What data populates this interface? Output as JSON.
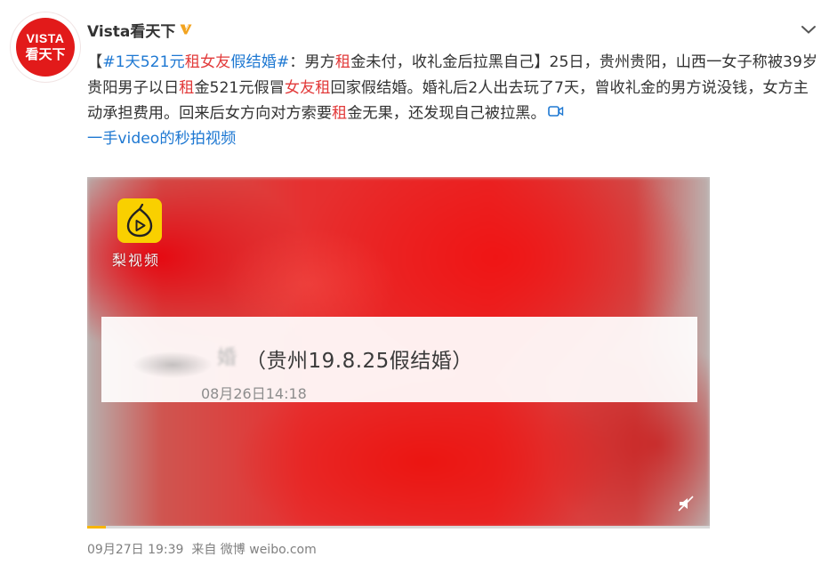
{
  "author": {
    "name": "Vista看天下",
    "avatar_text_top": "VISTA",
    "avatar_text_bottom": "看天下",
    "verified_icon": "verified-badge-icon"
  },
  "post": {
    "segments": [
      {
        "text": "【",
        "style": "normal"
      },
      {
        "text": "#1天521元",
        "style": "link"
      },
      {
        "text": "租",
        "style": "red"
      },
      {
        "text": "女友",
        "style": "red"
      },
      {
        "text": "假结婚#",
        "style": "link"
      },
      {
        "text": "：男方",
        "style": "normal"
      },
      {
        "text": "租",
        "style": "red"
      },
      {
        "text": "金未付，收礼金后拉黑自己】25日，贵州贵阳，山西一女子称被39岁贵阳男子以日",
        "style": "normal"
      },
      {
        "text": "租",
        "style": "red"
      },
      {
        "text": "金521元假冒",
        "style": "normal"
      },
      {
        "text": "女友",
        "style": "red"
      },
      {
        "text": "租",
        "style": "red"
      },
      {
        "text": "回家假结婚。婚礼后2人出去玩了7天，曾收礼金的男方说没钱，女方主动承担费用。回来后女方向对方索要",
        "style": "normal"
      },
      {
        "text": "租",
        "style": "red"
      },
      {
        "text": "金无果，还发现自己被拉黑。",
        "style": "normal"
      }
    ],
    "video_link_text": "一手video的秒拍视频",
    "video_link_icon": "video-link-icon"
  },
  "video": {
    "watermark_logo": "pear-video-logo-icon",
    "watermark_label": "梨视频",
    "banner_title": "（贵州19.8.25假结婚）",
    "banner_blur_char": "婚",
    "banner_time": "08月26日14:18",
    "mute_icon": "mute-speaker-icon",
    "progress": 0.03
  },
  "meta": {
    "date": "09月27日 19:39",
    "from_label": "来自",
    "source": "微博 weibo.com"
  },
  "colors": {
    "link": "#1e78d2",
    "keyword": "#e23a3a",
    "avatar": "#e21a1a",
    "pear_logo": "#f9d000",
    "progress": "#f7b500"
  }
}
